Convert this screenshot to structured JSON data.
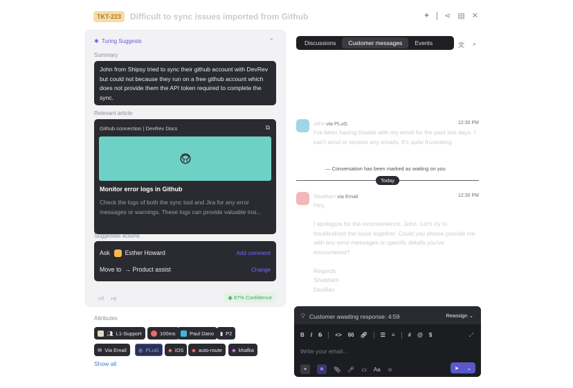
{
  "header": {
    "ticket_id": "TKT-223",
    "title": "Difficult to sync issues imported from Github",
    "icons": [
      "sparkle-icon",
      "share-icon",
      "panel-icon",
      "close-icon"
    ]
  },
  "suggest": {
    "heading": "Turing Suggests",
    "summary_label": "Summary",
    "summary_text": "John from Shipsy tried to sync their github account with DevRev but could not because they run on a free github account which does not provide them the API token required to complete the sync.",
    "relevant_label": "Relevant article",
    "article": {
      "source": "Github connection | DevRev Docs",
      "title": "Monitor error logs in Github",
      "body": "Check the logs of both the sync tool and Jira for any error messages or warnings. These logs can provide valuable insi..."
    },
    "actions_label": "Suggested actions",
    "actions": [
      {
        "prefix": "Ask",
        "target": "Esther Howard",
        "link": "Add comment"
      },
      {
        "prefix": "Move to",
        "target": "→ Product assist",
        "link": "Change"
      }
    ],
    "confidence": "87% Confidence"
  },
  "attributes": {
    "label": "Attributes",
    "chips_row1": [
      "L1-Support",
      "100ms",
      "Paul Dano",
      "P2"
    ],
    "chips_row2": [
      "Via Email",
      "PLuG",
      "iOS",
      "auto-route",
      "khafka"
    ],
    "show_all": "Show all"
  },
  "tabs": {
    "items": [
      "Discussions",
      "Customer messages",
      "Events"
    ],
    "active": "Customer messages"
  },
  "messages": [
    {
      "name": "John",
      "via": "via PLuG",
      "time": "12:30 PM",
      "body": "I've been having trouble with my email for the past two days. I can't send or receive any emails. It's quite frustrating."
    },
    {
      "name": "Shubham",
      "via": "via Email",
      "time": "12:30 PM",
      "body_lines": [
        "Hey,",
        "",
        "I apologize for the inconvenience, John. Let's try to troubleshoot the issue together. Could you please provide me with any error messages or specific details you've encountered?",
        "",
        "Regards",
        "Shubham",
        "DevRev"
      ]
    }
  ],
  "waiting_note": "Conversation has been marked as waiting on you",
  "today_label": "Today",
  "composer": {
    "status": "Customer awaiting response: 4:59",
    "reassign": "Reassign",
    "placeholder": "Write your email...",
    "toolbar": [
      "B",
      "I",
      "S",
      "<>",
      "66",
      "link",
      "list",
      "numlist",
      "#",
      "@",
      "$"
    ]
  },
  "colors": {
    "accent": "#6b57e6",
    "article_image": "#6ed1c5",
    "ticket_badge": "#f6dca7",
    "confidence": "#47a05f"
  }
}
